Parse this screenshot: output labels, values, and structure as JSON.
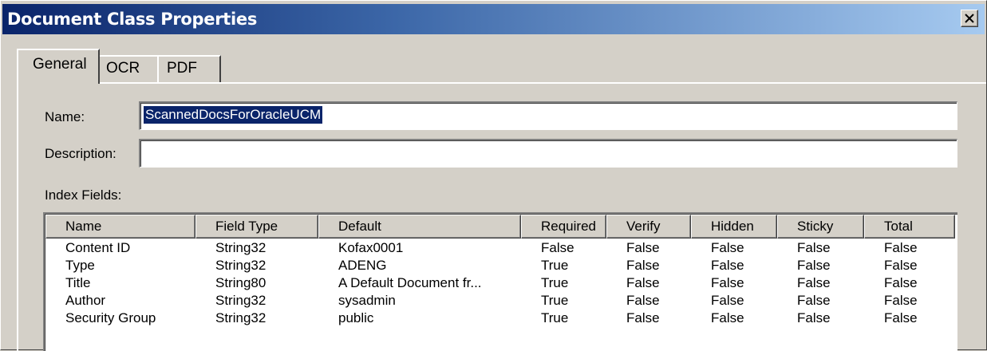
{
  "window": {
    "title": "Document Class Properties"
  },
  "tabs": [
    {
      "label": "General",
      "active": true
    },
    {
      "label": "OCR",
      "active": false
    },
    {
      "label": "PDF",
      "active": false
    }
  ],
  "form": {
    "name_label": "Name:",
    "name_value": "ScannedDocsForOracleUCM",
    "description_label": "Description:",
    "description_value": "",
    "index_fields_label": "Index Fields:"
  },
  "index_fields": {
    "columns": [
      "Name",
      "Field Type",
      "Default",
      "Required",
      "Verify",
      "Hidden",
      "Sticky",
      "Total"
    ],
    "rows": [
      [
        "Content ID",
        "String32",
        "Kofax0001",
        "False",
        "False",
        "False",
        "False",
        "False"
      ],
      [
        "Type",
        "String32",
        "ADENG",
        "True",
        "False",
        "False",
        "False",
        "False"
      ],
      [
        "Title",
        "String80",
        "A Default Document fr...",
        "True",
        "False",
        "False",
        "False",
        "False"
      ],
      [
        "Author",
        "String32",
        "sysadmin",
        "True",
        "False",
        "False",
        "False",
        "False"
      ],
      [
        "Security Group",
        "String32",
        "public",
        "True",
        "False",
        "False",
        "False",
        "False"
      ]
    ]
  },
  "icons": {
    "close": "close-icon"
  },
  "colors": {
    "title_gradient_start": "#0a246a",
    "title_gradient_end": "#a6caf0",
    "face": "#d4d0c8",
    "selection": "#0a246a"
  }
}
